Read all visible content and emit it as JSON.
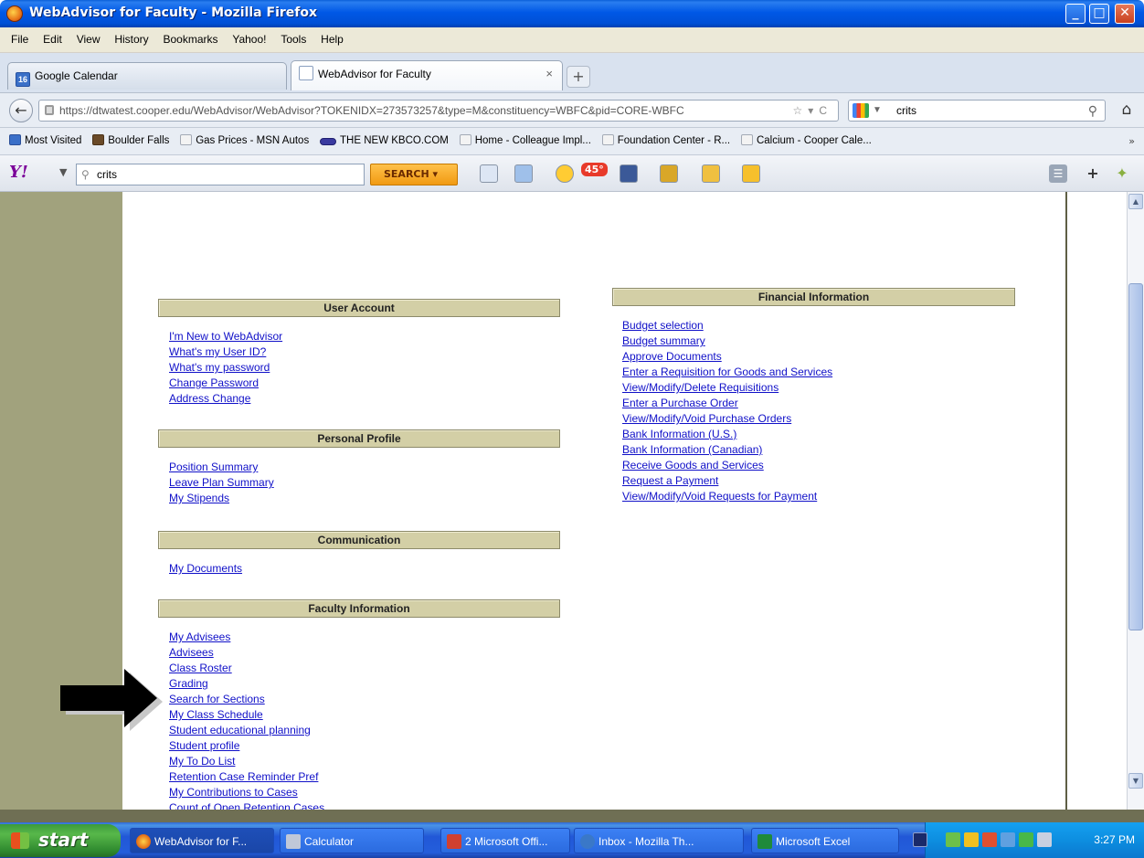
{
  "window": {
    "title": "WebAdvisor for Faculty - Mozilla Firefox"
  },
  "menu": [
    "File",
    "Edit",
    "View",
    "History",
    "Bookmarks",
    "Yahoo!",
    "Tools",
    "Help"
  ],
  "tabs": [
    {
      "label": "Google Calendar",
      "icon_text": "16"
    },
    {
      "label": "WebAdvisor for Faculty",
      "active": true
    }
  ],
  "nav": {
    "url": "https://dtwatest.cooper.edu/WebAdvisor/WebAdvisor?TOKENIDX=273573257&type=M&constituency=WBFC&pid=CORE-WBFC",
    "search_value": "crits"
  },
  "bookmarks": [
    "Most Visited",
    "Boulder Falls",
    "Gas Prices - MSN Autos",
    "THE NEW KBCO.COM",
    "Home - Colleague Impl...",
    "Foundation Center - R...",
    "Calcium - Cooper Cale..."
  ],
  "yahoo": {
    "search_value": "crits",
    "search_button": "SEARCH",
    "weather": "45°"
  },
  "sections": {
    "user_account": {
      "title": "User Account",
      "links": [
        "I'm New to WebAdvisor",
        "What's my User ID?",
        "What's my password",
        "Change Password",
        "Address Change"
      ]
    },
    "personal_profile": {
      "title": "Personal Profile",
      "links": [
        "Position Summary",
        "Leave Plan Summary",
        "My Stipends"
      ]
    },
    "communication": {
      "title": "Communication",
      "links": [
        "My Documents"
      ]
    },
    "faculty_information": {
      "title": "Faculty Information",
      "links": [
        "My Advisees",
        "Advisees",
        "Class Roster",
        "Grading",
        "Search for Sections",
        "My Class Schedule",
        "Student educational planning",
        "Student profile",
        "My To Do List",
        "Retention Case Reminder Pref",
        "My Contributions to Cases",
        "Count of Open Retention Cases"
      ]
    },
    "financial_information": {
      "title": "Financial Information",
      "links": [
        "Budget selection",
        "Budget summary",
        "Approve Documents",
        "Enter a Requisition for Goods and Services",
        "View/Modify/Delete Requisitions",
        "Enter a Purchase Order",
        "View/Modify/Void Purchase Orders",
        "Bank Information (U.S.)",
        "Bank Information (Canadian)",
        "Receive Goods and Services",
        "Request a Payment",
        "View/Modify/Void Requests for Payment"
      ]
    }
  },
  "taskbar": {
    "start": "start",
    "tasks": [
      "WebAdvisor for F...",
      "Calculator",
      "2 Microsoft Offi...",
      "Inbox - Mozilla Th...",
      "Microsoft Excel"
    ],
    "clock": "3:27 PM"
  },
  "colors": {
    "section_header_bg": "#d3cfa6",
    "link": "#1010c8",
    "page_bg_olive": "#7b7b51"
  }
}
